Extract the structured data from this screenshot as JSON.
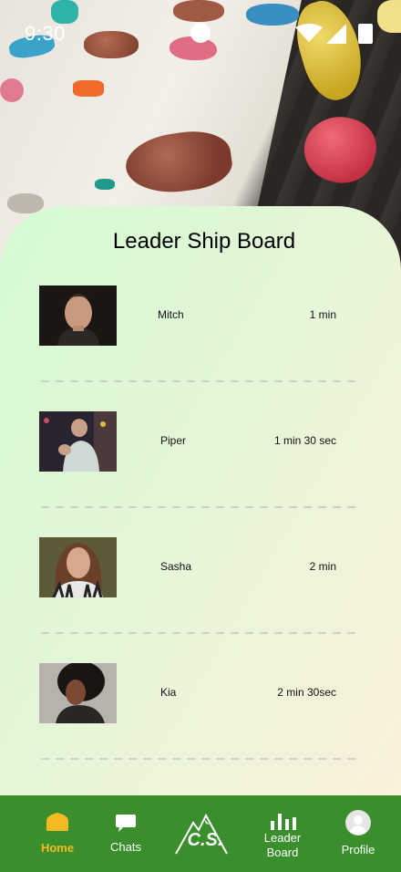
{
  "status_bar": {
    "time": "9:30"
  },
  "leaderboard": {
    "title": "Leader Ship Board",
    "entries": [
      {
        "name": "Mitch",
        "time": "1 min"
      },
      {
        "name": "Piper",
        "time": "1 min 30 sec"
      },
      {
        "name": "Sasha",
        "time": "2 min"
      },
      {
        "name": "Kia",
        "time": "2 min 30sec"
      }
    ]
  },
  "nav": {
    "home": "Home",
    "chats": "Chats",
    "logo_text": "C.S.",
    "leader_board_line1": "Leader",
    "leader_board_line2": "Board",
    "profile": "Profile"
  },
  "colors": {
    "nav_background": "#3a8f2c",
    "nav_active": "#f5b921",
    "card_gradient_start": "#d4fad2",
    "card_gradient_end": "#fbf0dc"
  },
  "icons": {
    "home": "home-icon",
    "chats": "chat-bubble-icon",
    "logo": "mountain-logo-icon",
    "leader_board": "bar-chart-icon",
    "profile": "profile-avatar-icon"
  }
}
